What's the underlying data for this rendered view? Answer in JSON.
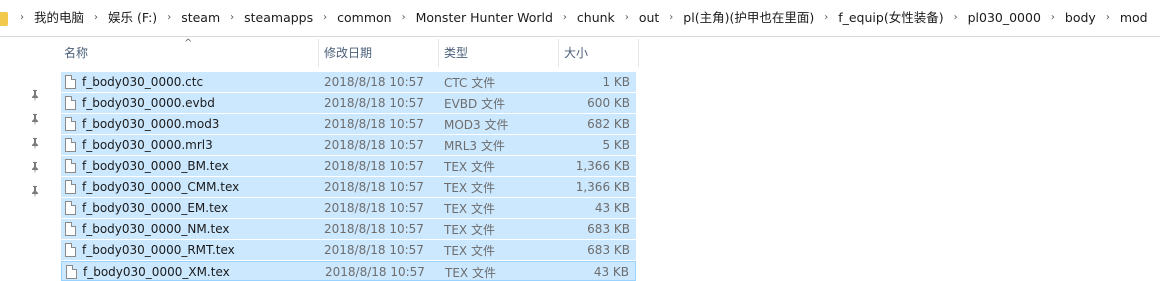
{
  "breadcrumb": [
    "我的电脑",
    "娱乐 (F:)",
    "steam",
    "steamapps",
    "common",
    "Monster Hunter World",
    "chunk",
    "out",
    "pl(主角)(护甲也在里面)",
    "f_equip(女性装备)",
    "pl030_0000",
    "body",
    "mod"
  ],
  "columns": {
    "name": "名称",
    "date": "修改日期",
    "type": "类型",
    "size": "大小"
  },
  "sort_indicator": "^",
  "files": [
    {
      "name": "f_body030_0000.ctc",
      "date": "2018/8/18 10:57",
      "type": "CTC 文件",
      "size": "1 KB"
    },
    {
      "name": "f_body030_0000.evbd",
      "date": "2018/8/18 10:57",
      "type": "EVBD 文件",
      "size": "600 KB"
    },
    {
      "name": "f_body030_0000.mod3",
      "date": "2018/8/18 10:57",
      "type": "MOD3 文件",
      "size": "682 KB"
    },
    {
      "name": "f_body030_0000.mrl3",
      "date": "2018/8/18 10:57",
      "type": "MRL3 文件",
      "size": "5 KB"
    },
    {
      "name": "f_body030_0000_BM.tex",
      "date": "2018/8/18 10:57",
      "type": "TEX 文件",
      "size": "1,366 KB"
    },
    {
      "name": "f_body030_0000_CMM.tex",
      "date": "2018/8/18 10:57",
      "type": "TEX 文件",
      "size": "1,366 KB"
    },
    {
      "name": "f_body030_0000_EM.tex",
      "date": "2018/8/18 10:57",
      "type": "TEX 文件",
      "size": "43 KB"
    },
    {
      "name": "f_body030_0000_NM.tex",
      "date": "2018/8/18 10:57",
      "type": "TEX 文件",
      "size": "683 KB"
    },
    {
      "name": "f_body030_0000_RMT.tex",
      "date": "2018/8/18 10:57",
      "type": "TEX 文件",
      "size": "683 KB"
    },
    {
      "name": "f_body030_0000_XM.tex",
      "date": "2018/8/18 10:57",
      "type": "TEX 文件",
      "size": "43 KB"
    }
  ],
  "pins": [
    "pin-icon",
    "pin-icon",
    "pin-icon",
    "pin-icon",
    "pin-icon"
  ],
  "colors": {
    "selection": "#cce8ff",
    "selection_border": "#99d1ff",
    "header_text": "#4c607a",
    "meta_text": "#6d6d6d",
    "folder": "#f2c94c"
  }
}
